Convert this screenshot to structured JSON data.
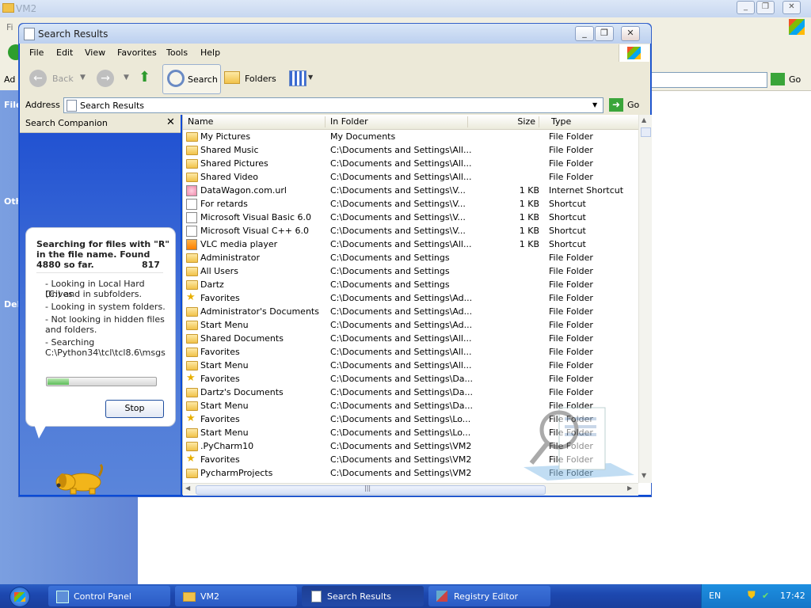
{
  "background_window": {
    "title": "VM2",
    "menu_partial": "Fi",
    "address_label_partial": "Ad",
    "go_label": "Go",
    "side_labels": [
      "File",
      "Oth",
      "Del"
    ]
  },
  "window": {
    "title": "Search Results",
    "menu": [
      "File",
      "Edit",
      "View",
      "Favorites",
      "Tools",
      "Help"
    ],
    "toolbar": {
      "back": "Back",
      "search": "Search",
      "folders": "Folders"
    },
    "address_label": "Address",
    "address_value": "Search Results",
    "go_label": "Go"
  },
  "search_pane": {
    "title": "Search Companion",
    "status_lines": [
      "Searching for files with \"R\"",
      "in the file name.  Found",
      "4880 so far."
    ],
    "status_count": "817",
    "details": [
      "- Looking in Local Hard Drives",
      "(C:) and in subfolders.",
      "- Looking in system folders.",
      "- Not looking in hidden files",
      "and folders.",
      "- Searching",
      "C:\\Python34\\tcl\\tcl8.6\\msgs"
    ],
    "stop_label": "Stop",
    "progress_fraction": 0.2
  },
  "columns": {
    "name": "Name",
    "folder": "In Folder",
    "size": "Size",
    "type": "Type"
  },
  "files": [
    {
      "name": "My Pictures",
      "folder": "My Documents",
      "size": "",
      "type": "File Folder",
      "icon": "pictures-folder-icon"
    },
    {
      "name": "Shared Music",
      "folder": "C:\\Documents and Settings\\All...",
      "size": "",
      "type": "File Folder",
      "icon": "music-folder-icon"
    },
    {
      "name": "Shared Pictures",
      "folder": "C:\\Documents and Settings\\All...",
      "size": "",
      "type": "File Folder",
      "icon": "pictures-folder-icon"
    },
    {
      "name": "Shared Video",
      "folder": "C:\\Documents and Settings\\All...",
      "size": "",
      "type": "File Folder",
      "icon": "video-folder-icon"
    },
    {
      "name": "DataWagon.com.url",
      "folder": "C:\\Documents and Settings\\V...",
      "size": "1 KB",
      "type": "Internet Shortcut",
      "icon": "internet-shortcut-icon"
    },
    {
      "name": "For retards",
      "folder": "C:\\Documents and Settings\\V...",
      "size": "1 KB",
      "type": "Shortcut",
      "icon": "shortcut-icon"
    },
    {
      "name": "Microsoft Visual Basic 6.0",
      "folder": "C:\\Documents and Settings\\V...",
      "size": "1 KB",
      "type": "Shortcut",
      "icon": "app-shortcut-icon"
    },
    {
      "name": "Microsoft Visual C++ 6.0",
      "folder": "C:\\Documents and Settings\\V...",
      "size": "1 KB",
      "type": "Shortcut",
      "icon": "app-shortcut-icon"
    },
    {
      "name": "VLC media player",
      "folder": "C:\\Documents and Settings\\All...",
      "size": "1 KB",
      "type": "Shortcut",
      "icon": "vlc-icon"
    },
    {
      "name": "Administrator",
      "folder": "C:\\Documents and Settings",
      "size": "",
      "type": "File Folder",
      "icon": "folder-icon"
    },
    {
      "name": "All Users",
      "folder": "C:\\Documents and Settings",
      "size": "",
      "type": "File Folder",
      "icon": "folder-icon"
    },
    {
      "name": "Dartz",
      "folder": "C:\\Documents and Settings",
      "size": "",
      "type": "File Folder",
      "icon": "folder-icon"
    },
    {
      "name": "Favorites",
      "folder": "C:\\Documents and Settings\\Ad...",
      "size": "",
      "type": "File Folder",
      "icon": "star-icon"
    },
    {
      "name": "Administrator's Documents",
      "folder": "C:\\Documents and Settings\\Ad...",
      "size": "",
      "type": "File Folder",
      "icon": "folder-icon"
    },
    {
      "name": "Start Menu",
      "folder": "C:\\Documents and Settings\\Ad...",
      "size": "",
      "type": "File Folder",
      "icon": "folder-icon"
    },
    {
      "name": "Shared Documents",
      "folder": "C:\\Documents and Settings\\All...",
      "size": "",
      "type": "File Folder",
      "icon": "folder-icon"
    },
    {
      "name": "Favorites",
      "folder": "C:\\Documents and Settings\\All...",
      "size": "",
      "type": "File Folder",
      "icon": "folder-icon"
    },
    {
      "name": "Start Menu",
      "folder": "C:\\Documents and Settings\\All...",
      "size": "",
      "type": "File Folder",
      "icon": "folder-icon"
    },
    {
      "name": "Favorites",
      "folder": "C:\\Documents and Settings\\Da...",
      "size": "",
      "type": "File Folder",
      "icon": "star-icon"
    },
    {
      "name": "Dartz's Documents",
      "folder": "C:\\Documents and Settings\\Da...",
      "size": "",
      "type": "File Folder",
      "icon": "folder-icon"
    },
    {
      "name": "Start Menu",
      "folder": "C:\\Documents and Settings\\Da...",
      "size": "",
      "type": "File Folder",
      "icon": "folder-icon"
    },
    {
      "name": "Favorites",
      "folder": "C:\\Documents and Settings\\Lo...",
      "size": "",
      "type": "File Folder",
      "icon": "star-icon"
    },
    {
      "name": "Start Menu",
      "folder": "C:\\Documents and Settings\\Lo...",
      "size": "",
      "type": "File Folder",
      "icon": "folder-icon"
    },
    {
      "name": ".PyCharm10",
      "folder": "C:\\Documents and Settings\\VM2",
      "size": "",
      "type": "File Folder",
      "icon": "folder-icon"
    },
    {
      "name": "Favorites",
      "folder": "C:\\Documents and Settings\\VM2",
      "size": "",
      "type": "File Folder",
      "icon": "star-icon"
    },
    {
      "name": "PycharmProjects",
      "folder": "C:\\Documents and Settings\\VM2",
      "size": "",
      "type": "File Folder",
      "icon": "folder-icon"
    }
  ],
  "taskbar": {
    "tasks": [
      "Control Panel",
      "VM2",
      "Search Results",
      "Registry Editor"
    ],
    "language": "EN",
    "clock": "17:42"
  }
}
